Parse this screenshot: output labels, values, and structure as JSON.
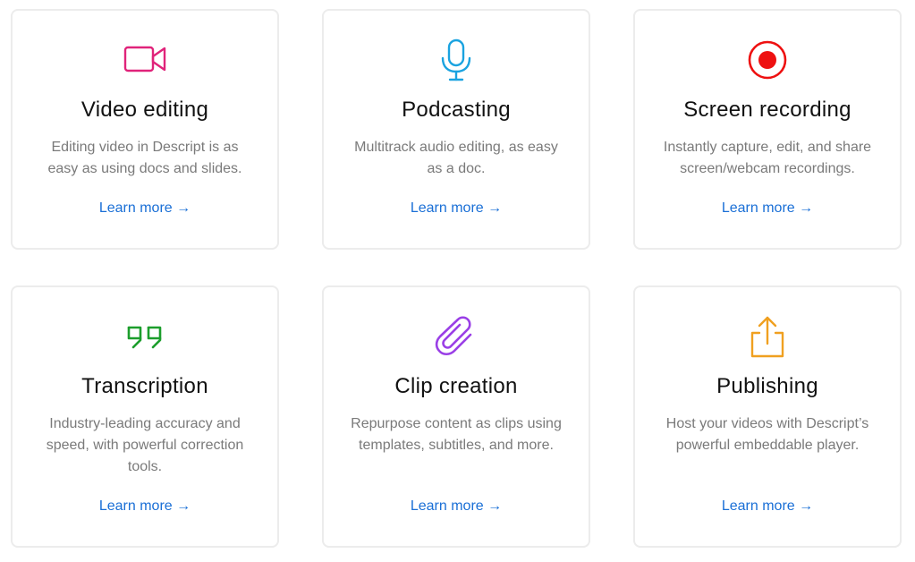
{
  "cards": [
    {
      "title": "Video editing",
      "description": "Editing video in Descript is  as easy as using docs and slides.",
      "link": "Learn more →",
      "icon": "video-camera-icon",
      "icon_color": "#e0237a"
    },
    {
      "title": "Podcasting",
      "description": "Multitrack audio editing,  as easy as a doc.",
      "link": "Learn more →",
      "icon": "microphone-icon",
      "icon_color": "#1aa3e0"
    },
    {
      "title": "Screen recording",
      "description": "Instantly capture, edit, and  share screen/webcam recordings.",
      "link": "Learn more →",
      "icon": "record-icon",
      "icon_color": "#ee1111"
    },
    {
      "title": "Transcription",
      "description": "Industry-leading accuracy and speed, with powerful correction tools.",
      "link": "Learn more →",
      "icon": "quote-icon",
      "icon_color": "#1c9e2c"
    },
    {
      "title": "Clip creation",
      "description": "Repurpose content as clips using templates, subtitles, and more.",
      "link": "Learn more →",
      "icon": "paperclip-icon",
      "icon_color": "#9a3fe6"
    },
    {
      "title": "Publishing",
      "description": "Host your videos with Descript’s powerful embeddable player.",
      "link": "Learn more →",
      "icon": "share-upload-icon",
      "icon_color": "#f0a020"
    }
  ]
}
